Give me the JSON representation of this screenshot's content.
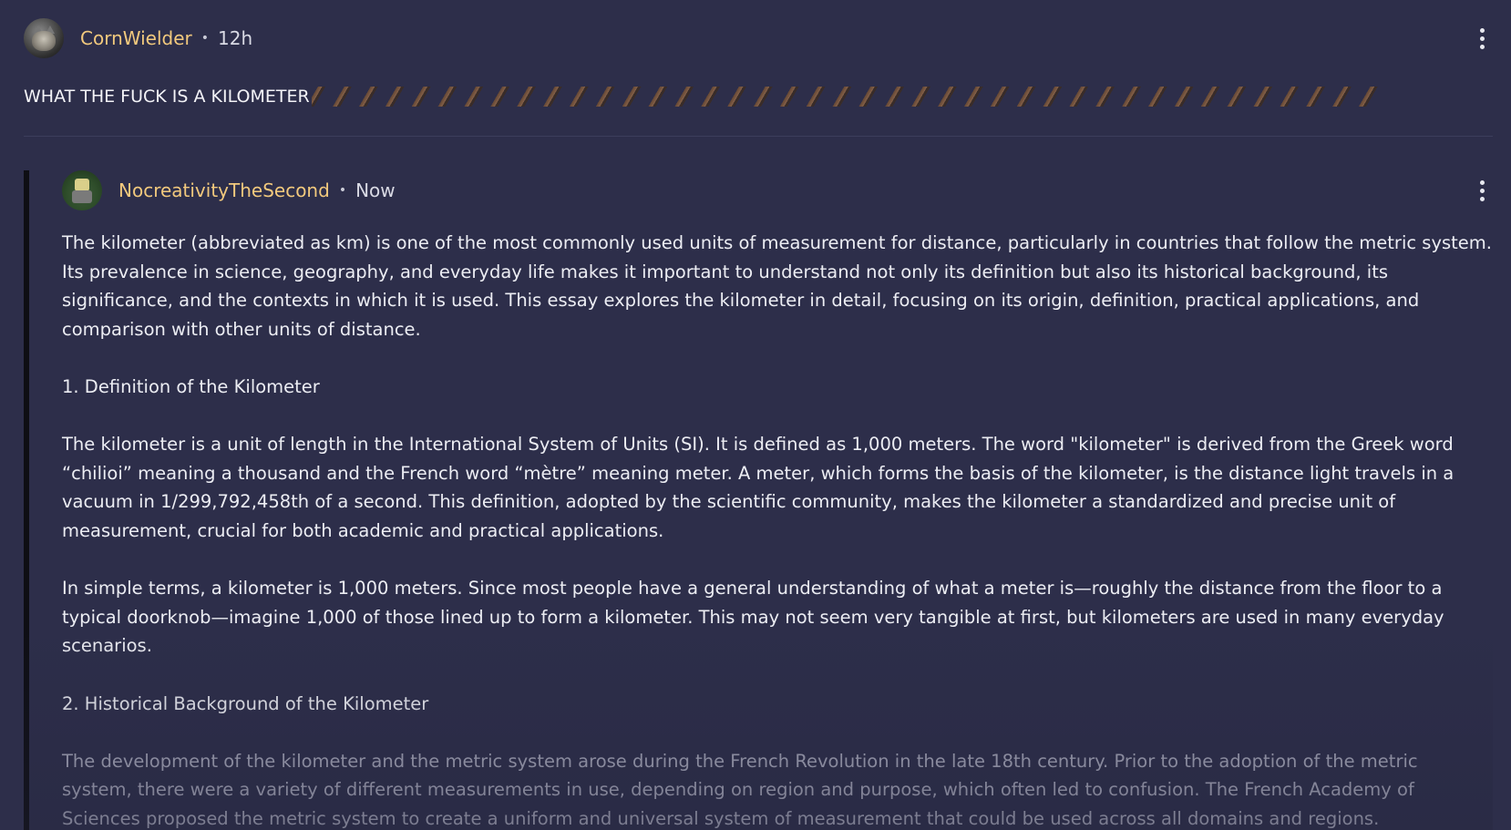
{
  "post": {
    "username": "CornWielder",
    "separator": "•",
    "time": "12h",
    "title": "WHAT THE FUCK IS A KILOMETER",
    "title_emoji_icon": "repeated-emoji-strip"
  },
  "reply": {
    "username": "NocreativityTheSecond",
    "separator": "•",
    "time": "Now",
    "paragraphs": [
      "The kilometer (abbreviated as km) is one of the most commonly used units of measurement for distance, particularly in countries that follow the metric system. Its prevalence in science, geography, and everyday life makes it important to understand not only its definition but also its historical background, its significance, and the contexts in which it is used. This essay explores the kilometer in detail, focusing on its origin, definition, practical applications, and comparison with other units of distance.",
      "1. Definition of the Kilometer",
      "The kilometer is a unit of length in the International System of Units (SI). It is defined as 1,000 meters. The word \"kilometer\" is derived from the Greek word “chilioi” meaning a thousand and the French word “mètre” meaning meter. A meter, which forms the basis of the kilometer, is the distance light travels in a vacuum in 1/299,792,458th of a second. This definition, adopted by the scientific community, makes the kilometer a standardized and precise unit of measurement, crucial for both academic and practical applications.",
      "In simple terms, a kilometer is 1,000 meters. Since most people have a general understanding of what a meter is—roughly the distance from the floor to a typical doorknob—imagine 1,000 of those lined up to form a kilometer. This may not seem very tangible at first, but kilometers are used in many everyday scenarios.",
      "2. Historical Background of the Kilometer",
      "The development of the kilometer and the metric system arose during the French Revolution in the late 18th century. Prior to the adoption of the metric system, there were a variety of different measurements in use, depending on region and purpose, which often led to confusion. The French Academy of Sciences proposed the metric system to create a uniform and universal system of measurement that could be used across all domains and regions."
    ]
  },
  "colors": {
    "background": "#2d2e4a",
    "username": "#f2c97d",
    "text": "#ecedf3",
    "faded_text": "#a8a9bb",
    "reply_bar": "#0e0e14"
  },
  "icons": {
    "more": "kebab-menu-icon"
  }
}
